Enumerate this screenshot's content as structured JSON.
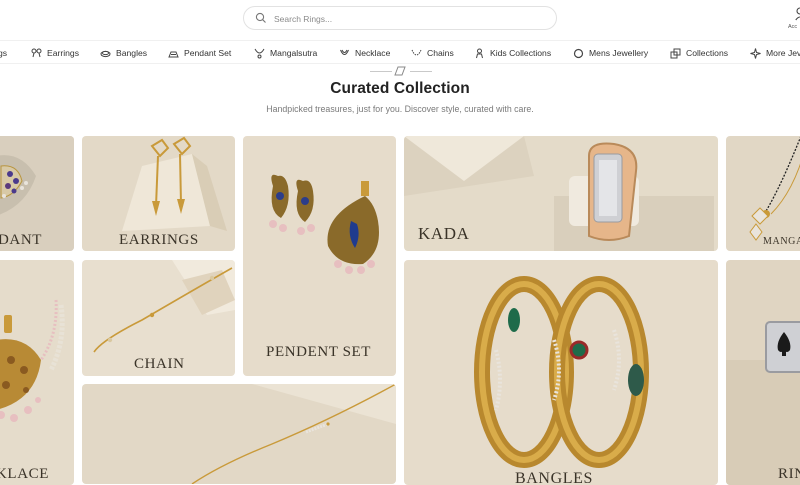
{
  "search": {
    "placeholder": "Search Rings..."
  },
  "account": {
    "label": "Acc"
  },
  "nav": [
    {
      "label": "gs"
    },
    {
      "label": "Earrings"
    },
    {
      "label": "Bangles"
    },
    {
      "label": "Pendant Set"
    },
    {
      "label": "Mangalsutra"
    },
    {
      "label": "Necklace"
    },
    {
      "label": "Chains"
    },
    {
      "label": "Kids Collections"
    },
    {
      "label": "Mens Jewellery"
    },
    {
      "label": "Collections"
    },
    {
      "label": "More Jev"
    }
  ],
  "section": {
    "title": "Curated Collection",
    "subtitle": "Handpicked treasures, just for you. Discover style, curated with care."
  },
  "tiles": {
    "pendant_partial": "DANT",
    "earrings": "EARRINGS",
    "kada": "KADA",
    "mangalsutra_partial": "MANGA",
    "necklace_partial": "KLACE",
    "chain": "CHAIN",
    "pendent_set": "PENDENT SET",
    "bangles": "BANGLES",
    "ring_partial": "RIN"
  },
  "colors": {
    "tile_bg": "#e6dccb",
    "gold": "#c99a3a",
    "caption": "#3a3328"
  }
}
